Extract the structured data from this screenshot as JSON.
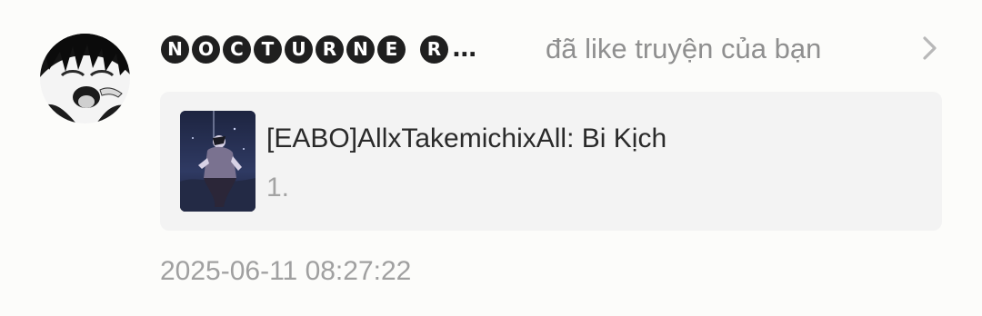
{
  "notification": {
    "user": {
      "name_letters": [
        "N",
        "O",
        "C",
        "T",
        "U",
        "R",
        "N",
        "E",
        " ",
        "R"
      ],
      "truncation": "...",
      "avatar_icon": "anime-avatar"
    },
    "action_text": "đã like truyện của bạn",
    "chevron_icon": "chevron-right-icon",
    "story": {
      "title": "[EABO]AllxTakemichixAll: Bi Kịch",
      "chapter": "1.",
      "cover_icon": "story-cover-image"
    },
    "timestamp": "2025-06-11 08:27:22"
  },
  "colors": {
    "background": "#fcfcfa",
    "card": "#f3f3f3",
    "username_badge": "#1f1f1f",
    "muted_text": "#8f8f8f",
    "title_text": "#2a2a2a"
  }
}
